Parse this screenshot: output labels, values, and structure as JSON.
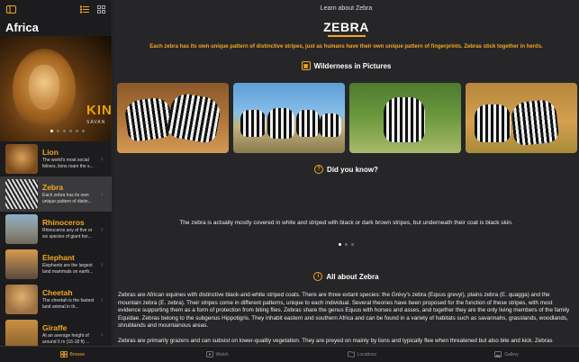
{
  "window": {
    "title": "Learn about Zebra"
  },
  "sidebar": {
    "title": "Africa",
    "hero": {
      "label": "KIN",
      "sublabel": "SAVAN"
    },
    "items": [
      {
        "name": "Lion",
        "desc": "The world's most social felines, lions roam the s..."
      },
      {
        "name": "Zebra",
        "desc": "Each zebra has its own unique pattern of distin..."
      },
      {
        "name": "Rhinoceros",
        "desc": "Rhinoceros any of five or six species of giant hor..."
      },
      {
        "name": "Elephant",
        "desc": "Elephants are the largest land mammals on earth..."
      },
      {
        "name": "Cheetah",
        "desc": "The cheetah is the fastest land animal in th..."
      },
      {
        "name": "Giraffe",
        "desc": "At an average height of around 5 m (16-18 ft) ..."
      }
    ]
  },
  "main": {
    "title": "ZEBRA",
    "fact": "Each zebra has its own unique pattern of distinctive stripes, just as humans have their own unique pattern of fingerprints. Zebras stick together in herds.",
    "wilderness_title": "Wilderness in Pictures",
    "did_you_know_title": "Did you know?",
    "did_you_know_text": "The zebra is actually mostly covered in white and striped with black or dark brown stripes, but underneath their coat is black skin.",
    "about_title": "All about Zebra",
    "about_p1": "Zebras are African equines with distinctive black-and-white striped coats. There are three extant species: the Grévy's zebra (Equus grevyi), plains zebra (E. quagga) and the mountain zebra (E. zebra). Their stripes come in different patterns, unique to each individual. Several theories have been proposed for the function of these stripes, with most evidence supporting them as a form of protection from biting flies. Zebras share the genus Equus with horses and asses, and together they are the only living members of the family Equidae. Zebras belong to the subgenus Hippotigris. They inhabit eastern and southern Africa and can be found in a variety of habitats such as savannahs, grasslands, woodlands, shrublands and mountainous areas.",
    "about_p2": "Zebras are primarily grazers and can subsist on lower-quality vegetation. They are preyed on mainly by lions and typically flee when threatened but also bite and kick. Zebras"
  },
  "tabs": [
    "Browse",
    "Watch",
    "Locations",
    "Gallery"
  ],
  "icons": {
    "sidebar_toggle": "sidebar-toggle-icon",
    "list_view": "list-view-icon",
    "grid_view": "grid-view-icon"
  },
  "colors": {
    "accent": "#f5a623",
    "background": "#1c1c1e",
    "panel": "#262628"
  }
}
